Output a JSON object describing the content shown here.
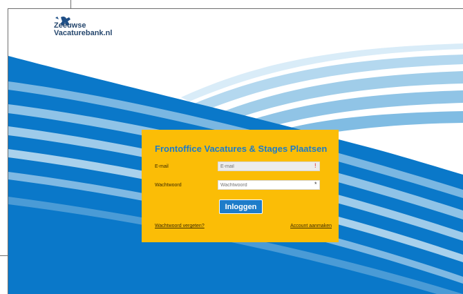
{
  "logo": {
    "text": "Zeeuwse\nVacaturebank.nl",
    "icon": "lion-icon"
  },
  "login": {
    "title": "Frontoffice Vacatures & Stages Plaatsen",
    "email": {
      "label": "E-mail",
      "placeholder": "E-mail",
      "value": "",
      "required_mark": "!"
    },
    "password": {
      "label": "Wachtwoord",
      "placeholder": "Wachtwoord",
      "value": "",
      "required_mark": "*"
    },
    "submit_label": "Inloggen",
    "forgot_link": "Wachtwoord vergeten?",
    "create_account_link": "Account aanmaken"
  },
  "colors": {
    "panel": "#fbbd06",
    "accent_blue": "#1e7cc9",
    "wave_dark": "#0a78c9",
    "wave_light": "#9fcde9",
    "error_mark": "#e02424"
  }
}
